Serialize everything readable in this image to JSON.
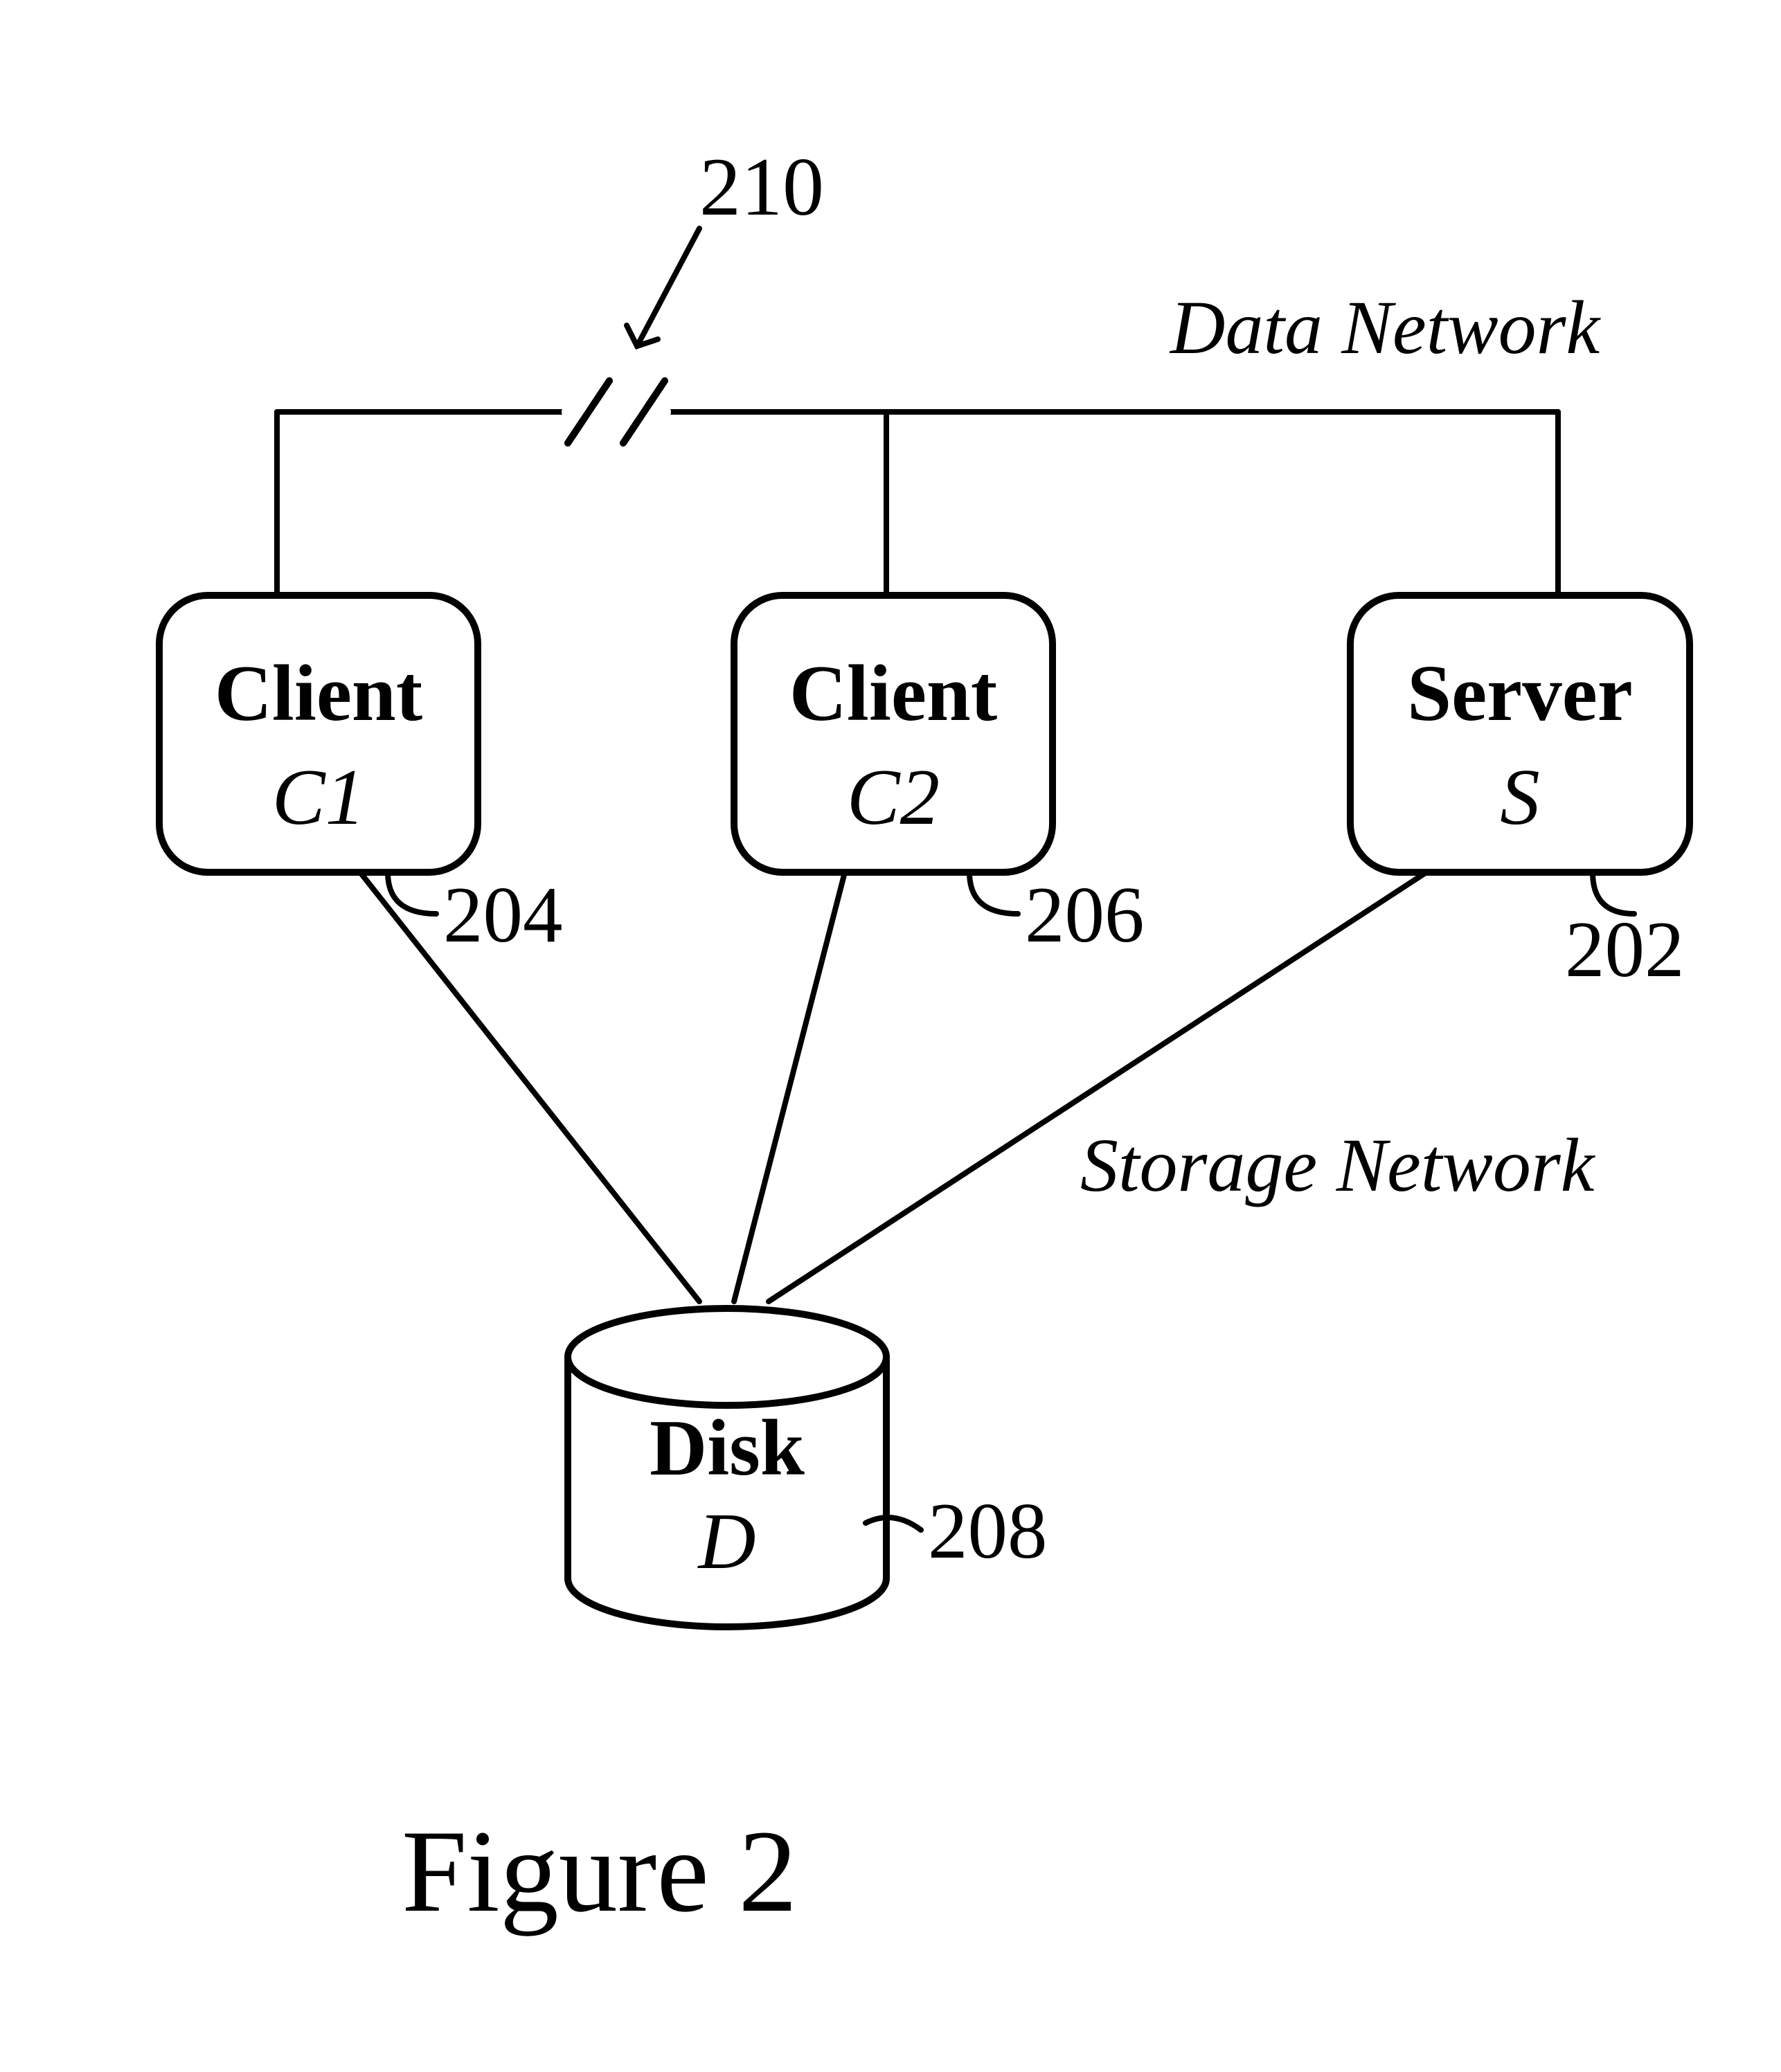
{
  "labels": {
    "data_network": "Data Network",
    "storage_network": "Storage Network",
    "figure_caption": "Figure 2"
  },
  "refs": {
    "r210": "210",
    "r204": "204",
    "r206": "206",
    "r202": "202",
    "r208": "208"
  },
  "nodes": {
    "client1": {
      "title": "Client",
      "sub": "C1"
    },
    "client2": {
      "title": "Client",
      "sub": "C2"
    },
    "server": {
      "title": "Server",
      "sub": "S"
    },
    "disk": {
      "title": "Disk",
      "sub": "D"
    }
  }
}
